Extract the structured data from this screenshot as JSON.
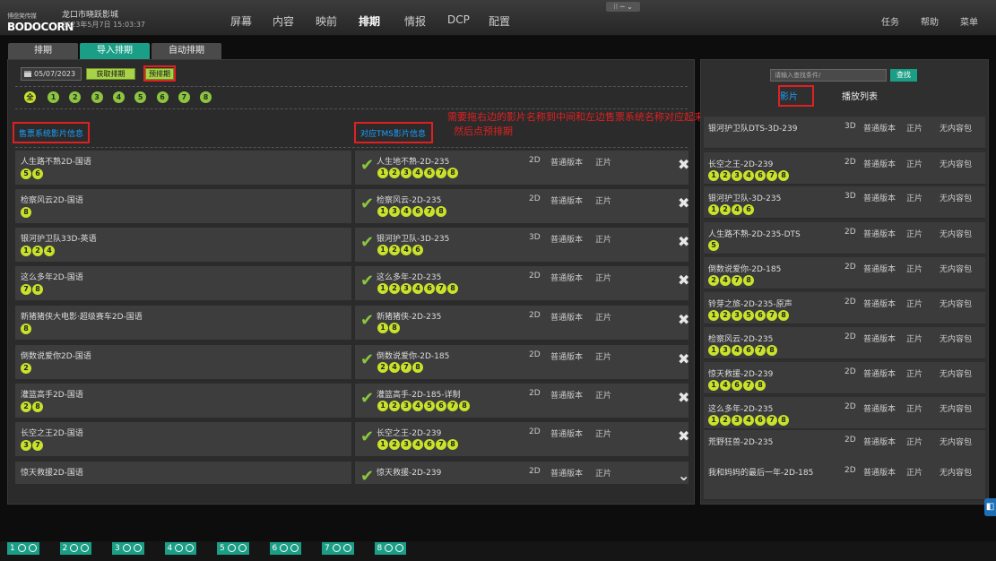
{
  "header": {
    "logo": "BODOCORN",
    "logo_small": "博盘笑传媒",
    "cinema": "龙口市晓跃影城",
    "clock": "2023年5月7日 15:03:37",
    "nav": [
      "屏幕",
      "内容",
      "映前",
      "排期",
      "情报",
      "DCP",
      "配置"
    ],
    "active_nav": "排期",
    "right_nav": [
      "任务",
      "帮助",
      "菜单"
    ]
  },
  "tabs": [
    "排期",
    "导入排期",
    "自动排期"
  ],
  "active_tab": "导入排期",
  "toolbar": {
    "date": "05/07/2023",
    "fetch_label": "获取排期",
    "preview_label": "预排期"
  },
  "halls": {
    "all_label": "全",
    "numbers": [
      "1",
      "2",
      "3",
      "4",
      "5",
      "6",
      "7",
      "8"
    ]
  },
  "left_header": "售票系统影片信息",
  "mid_header": "对应TMS影片信息",
  "instruction": [
    "需要拖右边的影片名称到中间和左边售票系统名称对应起来",
    "然后点预排期"
  ],
  "left_rows": [
    {
      "title": "人生路不熟2D-国语",
      "halls": [
        "5",
        "6"
      ]
    },
    {
      "title": "检察风云2D-国语",
      "halls": [
        "8"
      ]
    },
    {
      "title": "银河护卫队33D-英语",
      "halls": [
        "1",
        "2",
        "4"
      ]
    },
    {
      "title": "这么多年2D-国语",
      "halls": [
        "7",
        "8"
      ]
    },
    {
      "title": "新猪猪侠大电影·超级赛车2D-国语",
      "halls": [
        "8"
      ]
    },
    {
      "title": "倒数说爱你2D-国语",
      "halls": [
        "2"
      ]
    },
    {
      "title": "灌篮高手2D-国语",
      "halls": [
        "2",
        "8"
      ]
    },
    {
      "title": "长空之王2D-国语",
      "halls": [
        "3",
        "7"
      ]
    },
    {
      "title": "惊天救援2D-国语",
      "halls": []
    }
  ],
  "mid_rows": [
    {
      "title": "人生地不熟-2D-235",
      "halls": [
        "1",
        "2",
        "3",
        "4",
        "6",
        "7",
        "8"
      ],
      "format": "2D",
      "version": "普通版本",
      "type": "正片"
    },
    {
      "title": "检察风云-2D-235",
      "halls": [
        "1",
        "3",
        "4",
        "6",
        "7",
        "8"
      ],
      "format": "2D",
      "version": "普通版本",
      "type": "正片"
    },
    {
      "title": "银河护卫队-3D-235",
      "halls": [
        "1",
        "2",
        "4",
        "6"
      ],
      "format": "3D",
      "version": "普通版本",
      "type": "正片"
    },
    {
      "title": "这么多年-2D-235",
      "halls": [
        "1",
        "2",
        "3",
        "4",
        "6",
        "7",
        "8"
      ],
      "format": "2D",
      "version": "普通版本",
      "type": "正片"
    },
    {
      "title": "新猪猪侠-2D-235",
      "halls": [
        "1",
        "8"
      ],
      "format": "2D",
      "version": "普通版本",
      "type": "正片"
    },
    {
      "title": "倒数说爱你-2D-185",
      "halls": [
        "2",
        "4",
        "7",
        "8"
      ],
      "format": "2D",
      "version": "普通版本",
      "type": "正片"
    },
    {
      "title": "灌篮高手-2D-185-详制",
      "halls": [
        "1",
        "2",
        "3",
        "4",
        "5",
        "6",
        "7",
        "8"
      ],
      "format": "2D",
      "version": "普通版本",
      "type": "正片"
    },
    {
      "title": "长空之王-2D-239",
      "halls": [
        "1",
        "2",
        "3",
        "4",
        "6",
        "7",
        "8"
      ],
      "format": "2D",
      "version": "普通版本",
      "type": "正片"
    },
    {
      "title": "惊天救援-2D-239",
      "halls": [],
      "format": "2D",
      "version": "普通版本",
      "type": "正片"
    }
  ],
  "right": {
    "search_placeholder": "请输入查找条件/",
    "search_label": "查找",
    "tab_movies": "影片",
    "tab_playlist": "播放列表",
    "rows": [
      {
        "title": "银河护卫队DTS-3D-239",
        "halls": [],
        "format": "3D",
        "version": "普通版本",
        "type": "正片",
        "pkg": "无内容包"
      },
      {
        "title": "长空之王-2D-239",
        "halls": [
          "1",
          "2",
          "3",
          "4",
          "6",
          "7",
          "8"
        ],
        "format": "2D",
        "version": "普通版本",
        "type": "正片",
        "pkg": "无内容包"
      },
      {
        "title": "银河护卫队-3D-235",
        "halls": [
          "1",
          "2",
          "4",
          "6"
        ],
        "format": "3D",
        "version": "普通版本",
        "type": "正片",
        "pkg": "无内容包"
      },
      {
        "title": "人生路不熟-2D-235-DTS",
        "halls": [
          "5"
        ],
        "format": "2D",
        "version": "普通版本",
        "type": "正片",
        "pkg": "无内容包"
      },
      {
        "title": "倒数说爱你-2D-185",
        "halls": [
          "2",
          "4",
          "7",
          "8"
        ],
        "format": "2D",
        "version": "普通版本",
        "type": "正片",
        "pkg": "无内容包"
      },
      {
        "title": "铃芽之旅-2D-235-原声",
        "halls": [
          "1",
          "2",
          "3",
          "5",
          "6",
          "7",
          "8"
        ],
        "format": "2D",
        "version": "普通版本",
        "type": "正片",
        "pkg": "无内容包"
      },
      {
        "title": "检察风云-2D-235",
        "halls": [
          "1",
          "3",
          "4",
          "6",
          "7",
          "8"
        ],
        "format": "2D",
        "version": "普通版本",
        "type": "正片",
        "pkg": "无内容包"
      },
      {
        "title": "惊天救援-2D-239",
        "halls": [
          "1",
          "4",
          "6",
          "7",
          "8"
        ],
        "format": "2D",
        "version": "普通版本",
        "type": "正片",
        "pkg": "无内容包"
      },
      {
        "title": "这么多年-2D-235",
        "halls": [
          "1",
          "2",
          "3",
          "4",
          "6",
          "7",
          "8"
        ],
        "format": "2D",
        "version": "普通版本",
        "type": "正片",
        "pkg": "无内容包"
      },
      {
        "title": "荒野狂兽-2D-235",
        "halls": [],
        "format": "2D",
        "version": "普通版本",
        "type": "正片",
        "pkg": "无内容包"
      },
      {
        "title": "我和妈妈的最后一年-2D-185",
        "halls": [],
        "format": "2D",
        "version": "普通版本",
        "type": "正片",
        "pkg": "无内容包"
      }
    ]
  },
  "bottom_halls": [
    "1",
    "2",
    "3",
    "4",
    "5",
    "6",
    "7",
    "8"
  ]
}
